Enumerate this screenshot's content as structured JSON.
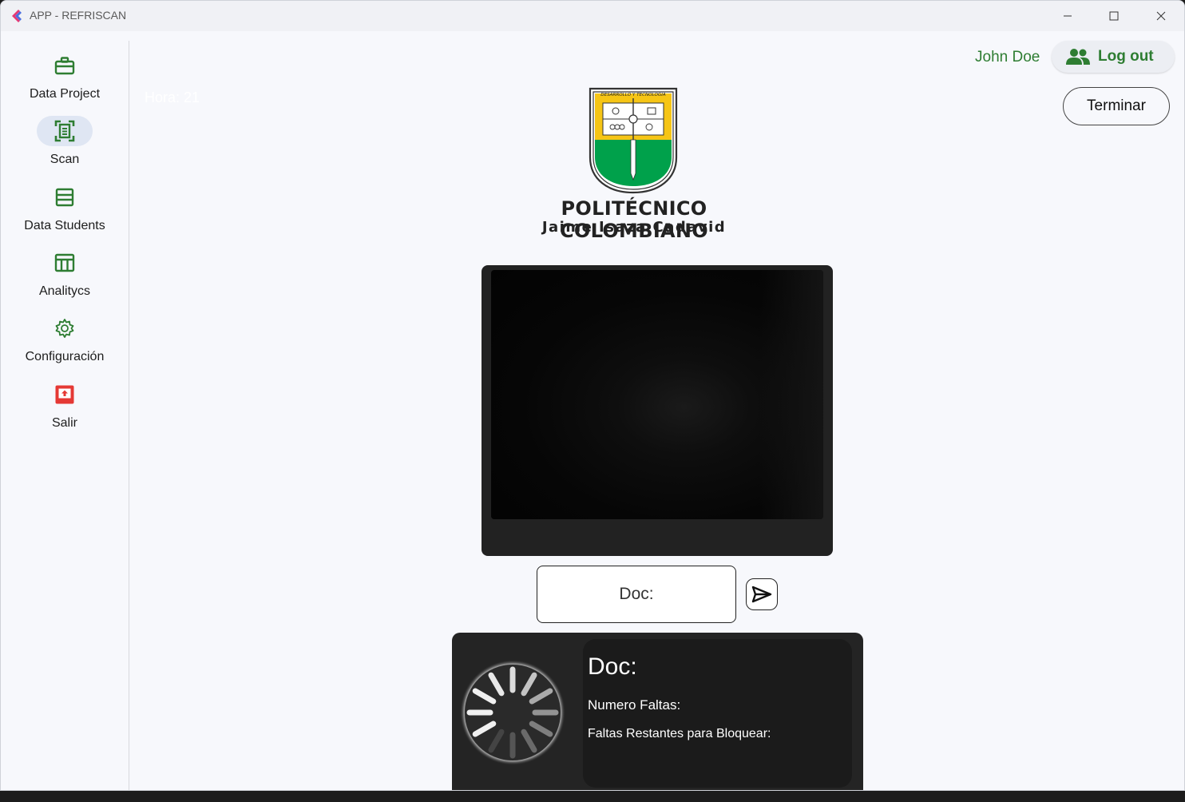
{
  "window": {
    "title": "APP - REFRISCAN"
  },
  "sidebar": {
    "items": [
      {
        "label": "Data Project",
        "icon": "briefcase-icon",
        "active": false
      },
      {
        "label": "Scan",
        "icon": "document-scanner-icon",
        "active": true
      },
      {
        "label": "Data Students",
        "icon": "list-icon",
        "active": false
      },
      {
        "label": "Analitycs",
        "icon": "table-icon",
        "active": false
      },
      {
        "label": "Configuración",
        "icon": "gear-icon",
        "active": false
      },
      {
        "label": "Salir",
        "icon": "exit-icon",
        "active": false
      }
    ]
  },
  "header": {
    "user_name": "John Doe",
    "logout_label": "Log out",
    "terminar_label": "Terminar",
    "hora_label": "Hora: 21"
  },
  "logo": {
    "crest_banner": "DESARROLLO Y TECNOLOGIA",
    "title": "POLITÉCNICO COLOMBIANO",
    "subtitle": "Jaime Isaza Cadavid"
  },
  "scan": {
    "doc_input_placeholder": "Doc:",
    "send_icon": "send-icon"
  },
  "info": {
    "doc_label": "Doc:",
    "faltas_label": "Numero Faltas:",
    "restantes_label": "Faltas Restantes para Bloquear:"
  },
  "colors": {
    "accent_green": "#2e7d32",
    "active_pill": "#dfe6f3",
    "exit_red": "#e53935",
    "panel_dark": "#242424"
  }
}
